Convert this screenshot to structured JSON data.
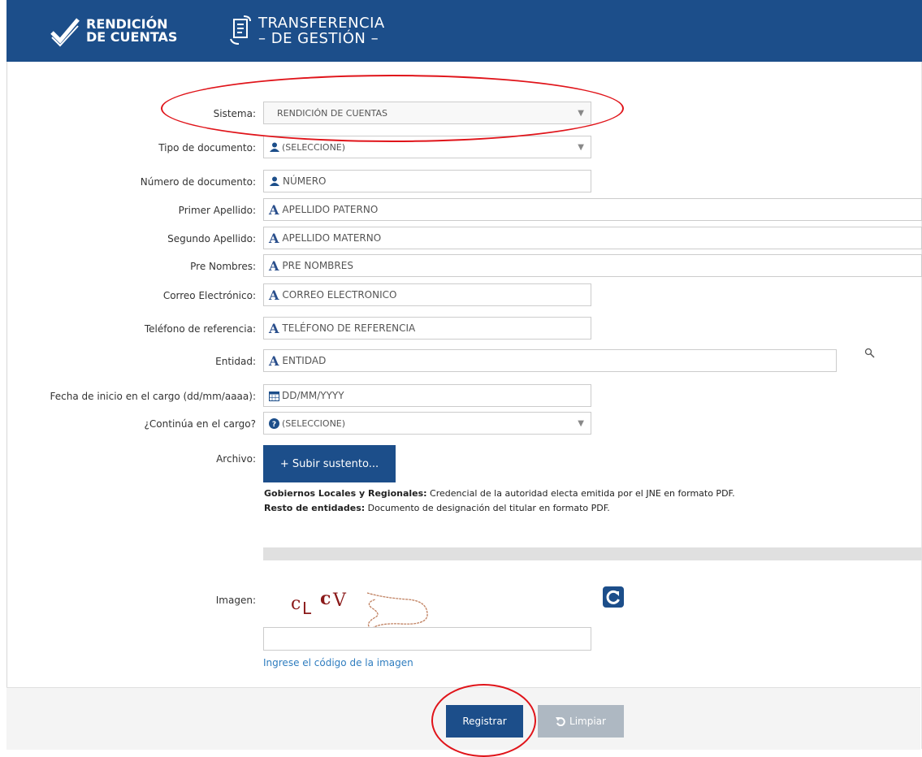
{
  "header": {
    "logo1_line1": "RENDICIÓN",
    "logo1_line2": "DE CUENTAS",
    "logo2_line1": "TRANSFERENCIA",
    "logo2_line2": "– DE GESTIÓN –"
  },
  "form": {
    "sistema": {
      "label": "Sistema:",
      "value": "RENDICIÓN DE CUENTAS"
    },
    "tipo_documento": {
      "label": "Tipo de documento:",
      "value": "(SELECCIONE)"
    },
    "numero_documento": {
      "label": "Número de documento:",
      "placeholder": "NÚMERO"
    },
    "primer_apellido": {
      "label": "Primer Apellido:",
      "placeholder": "APELLIDO PATERNO"
    },
    "segundo_apellido": {
      "label": "Segundo Apellido:",
      "placeholder": "APELLIDO MATERNO"
    },
    "pre_nombres": {
      "label": "Pre Nombres:",
      "placeholder": "PRE NOMBRES"
    },
    "correo": {
      "label": "Correo Electrónico:",
      "placeholder": "CORREO ELECTRONICO"
    },
    "telefono": {
      "label": "Teléfono de referencia:",
      "placeholder": "TELÉFONO DE REFERENCIA"
    },
    "entidad": {
      "label": "Entidad:",
      "placeholder": "ENTIDAD"
    },
    "fecha_inicio": {
      "label": "Fecha de inicio en el cargo (dd/mm/aaaa):",
      "placeholder": "DD/MM/YYYY"
    },
    "continua": {
      "label": "¿Continúa en el cargo?",
      "value": "(SELECCIONE)"
    },
    "archivo": {
      "label": "Archivo:",
      "button": "+ Subir sustento..."
    },
    "note1_bold": "Gobiernos Locales y Regionales:",
    "note1_text": " Credencial de la autoridad electa emitida por el JNE en formato PDF.",
    "note2_bold": "Resto de entidades:",
    "note2_text": " Documento de designación del titular en formato PDF.",
    "imagen": {
      "label": "Imagen:",
      "captcha_text": "cLCV",
      "hint": "Ingrese el código de la imagen"
    }
  },
  "footer": {
    "registrar": "Registrar",
    "limpiar": "Limpiar"
  },
  "colors": {
    "brand": "#1c4e8a",
    "highlight": "#e0141a",
    "link": "#2f7dbf"
  }
}
